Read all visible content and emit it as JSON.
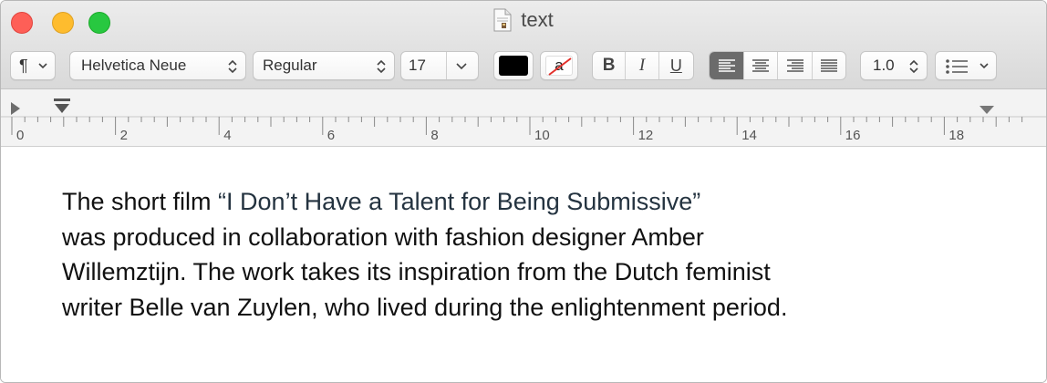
{
  "window": {
    "title": "text"
  },
  "toolbar": {
    "paragraph_style_icon": "paragraph-icon",
    "font_family": "Helvetica Neue",
    "font_style": "Regular",
    "font_size": "17",
    "text_color": "#000000",
    "background_color_glyph": "a",
    "bold": "B",
    "italic": "I",
    "underline": "U",
    "line_spacing": "1.0",
    "alignment_selected": "left",
    "list_icon": "bulleted-list-icon"
  },
  "ruler": {
    "labels": [
      "0",
      "2",
      "4",
      "6",
      "8",
      "10",
      "12",
      "14",
      "16",
      "18"
    ]
  },
  "document": {
    "line1_prefix": "The short film ",
    "line1_link": "“I Don’t Have a Talent for Being Submissive”",
    "line2": "was produced in collaboration with fashion designer Amber",
    "line3": "Willemztijn. The work takes its inspiration from the Dutch feminist",
    "line4": "writer Belle van Zuylen, who lived during the enlightenment period."
  }
}
